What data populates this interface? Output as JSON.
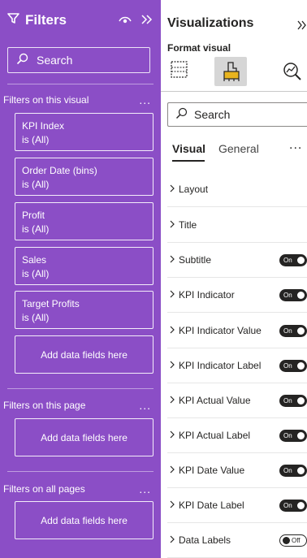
{
  "filters": {
    "title": "Filters",
    "search_placeholder": "Search",
    "visual_section": {
      "label": "Filters on this visual",
      "more": "..."
    },
    "visual_filters": [
      {
        "name": "KPI Index",
        "state": "is (All)"
      },
      {
        "name": "Order Date (bins)",
        "state": "is (All)"
      },
      {
        "name": "Profit",
        "state": "is (All)"
      },
      {
        "name": "Sales",
        "state": "is (All)"
      },
      {
        "name": "Target Profits",
        "state": "is (All)"
      }
    ],
    "add_fields_label": "Add data fields here",
    "page_section": {
      "label": "Filters on this page",
      "more": "..."
    },
    "all_pages_section": {
      "label": "Filters on all pages",
      "more": "..."
    }
  },
  "visualizations": {
    "title": "Visualizations",
    "format_label": "Format visual",
    "search_placeholder": "Search",
    "tabs": {
      "visual": "Visual",
      "general": "General",
      "more": "..."
    },
    "cards": [
      {
        "label": "Layout",
        "toggle": ""
      },
      {
        "label": "Title",
        "toggle": ""
      },
      {
        "label": "Subtitle",
        "toggle": "On"
      },
      {
        "label": "KPI Indicator",
        "toggle": "On"
      },
      {
        "label": "KPI Indicator Value",
        "toggle": "On"
      },
      {
        "label": "KPI Indicator Label",
        "toggle": "On"
      },
      {
        "label": "KPI Actual Value",
        "toggle": "On"
      },
      {
        "label": "KPI Actual Label",
        "toggle": "On"
      },
      {
        "label": "KPI Date Value",
        "toggle": "On"
      },
      {
        "label": "KPI Date Label",
        "toggle": "On"
      },
      {
        "label": "Data Labels",
        "toggle": "Off"
      }
    ]
  },
  "colors": {
    "filters_bg": "#8b4ec6",
    "toggle_on": "#252423"
  }
}
